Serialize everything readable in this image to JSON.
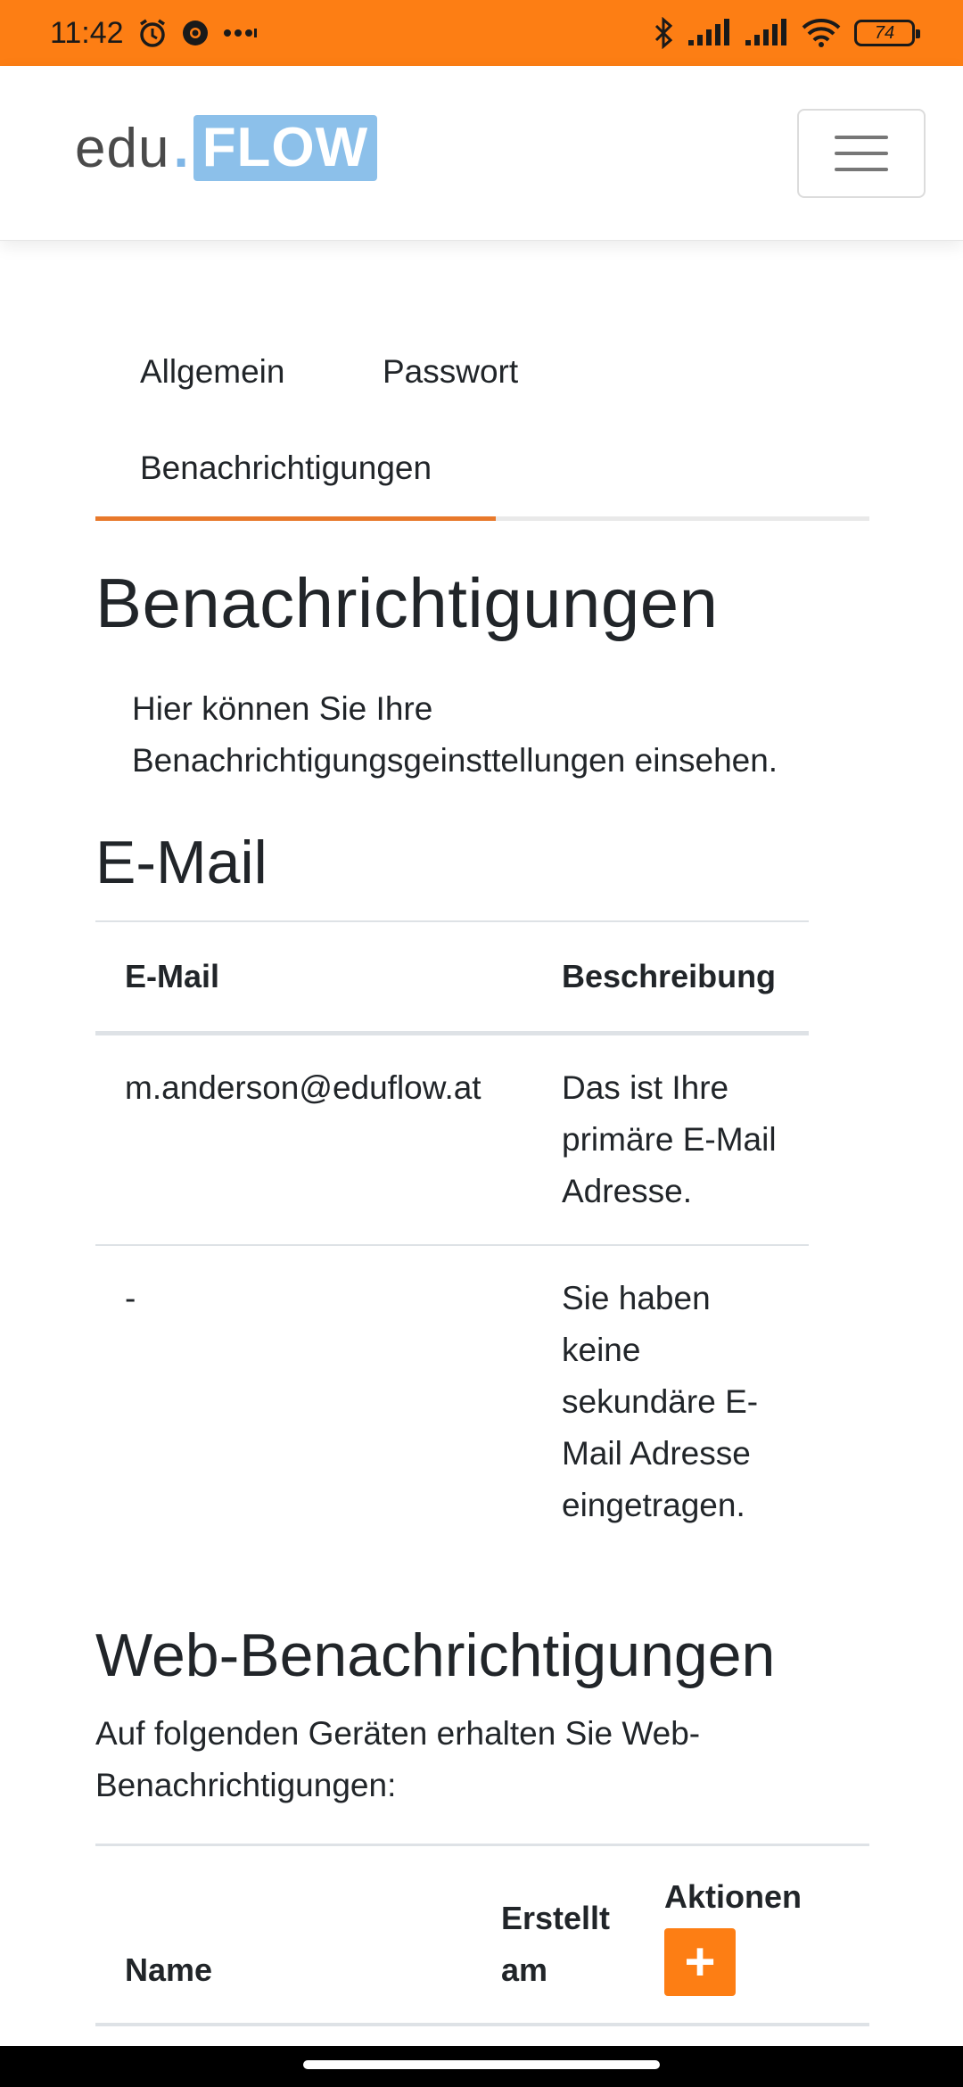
{
  "status_bar": {
    "time": "11:42",
    "battery": "74",
    "icons": [
      "alarm-icon",
      "chrome-icon",
      "more-icon",
      "bluetooth-icon",
      "signal-icon",
      "signal-icon",
      "wifi-icon",
      "battery-icon"
    ]
  },
  "brand": {
    "part1": "edu",
    "dot": ".",
    "part2": "FLOW"
  },
  "tabs": [
    {
      "label": "Allgemein"
    },
    {
      "label": "Passwort"
    },
    {
      "label": "Benachrichtigungen",
      "active": true
    }
  ],
  "page": {
    "title": "Benachrichtigungen",
    "intro": "Hier können Sie Ihre Benachrichtigungsgeinsttellungen einsehen."
  },
  "email_section": {
    "title": "E-Mail",
    "columns": [
      "E-Mail",
      "Beschreibung"
    ],
    "rows": [
      {
        "email": "m.anderson@eduflow.at",
        "description": "Das ist Ihre primäre E-Mail Adresse."
      },
      {
        "email": "-",
        "description": "Sie haben keine sekundäre E-Mail Adresse eingetragen."
      }
    ]
  },
  "web_section": {
    "title": "Web-Benachrichtigungen",
    "description": "Auf folgenden Geräten erhalten Sie Web-Benachrichtigungen:",
    "columns": [
      "Name",
      "Erstellt am",
      "Aktionen"
    ],
    "add_label": "+"
  },
  "colors": {
    "accent": "#fd7e14",
    "brand_blue": "#8cc0ea",
    "tab_active": "#e8792b"
  }
}
